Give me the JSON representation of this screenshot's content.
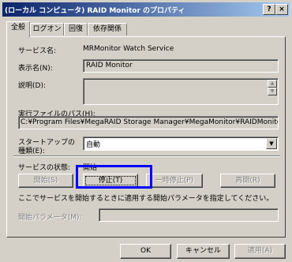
{
  "titlebar": {
    "title": "(ローカル コンピュータ) RAID Monitor のプロパティ",
    "help_button": "?",
    "close_button": "×"
  },
  "tabs": [
    "全般",
    "ログオン",
    "回復",
    "依存関係"
  ],
  "general": {
    "service_name_label": "サービス名:",
    "service_name_value": "MRMonitor Watch Service",
    "display_name_label": "表示名(N):",
    "display_name_value": "RAID Monitor",
    "description_label": "説明(D):",
    "description_value": "",
    "exe_path_label": "実行ファイルのパス(H):",
    "exe_path_value": "C:¥Program Files¥MegaRAID Storage Manager¥MegaMonitor¥RAIDMonitor.exe",
    "startup_type_label_line1": "スタートアップの",
    "startup_type_label_line2": "種類(E):",
    "startup_type_value": "自動",
    "service_status_label": "サービスの状態:",
    "service_status_value": "開始",
    "start_button": "開始(S)",
    "stop_button": "停止(T)",
    "pause_button": "一時停止(P)",
    "resume_button": "再開(R)",
    "hint_text": "ここでサービスを開始するときに適用する開始パラメータを指定してください。",
    "start_params_label": "開始パラメータ(M):",
    "start_params_value": ""
  },
  "footer": {
    "ok_button": "OK",
    "cancel_button": "キャンセル",
    "apply_button": "適用(A)"
  },
  "icons": {
    "spin_up": "▲",
    "spin_down": "▼",
    "dropdown": "▼"
  },
  "colors": {
    "titlebar_start": "#0a246a",
    "titlebar_end": "#a6caf0",
    "face": "#d4d0c8",
    "highlight_box": "#0000ff"
  }
}
